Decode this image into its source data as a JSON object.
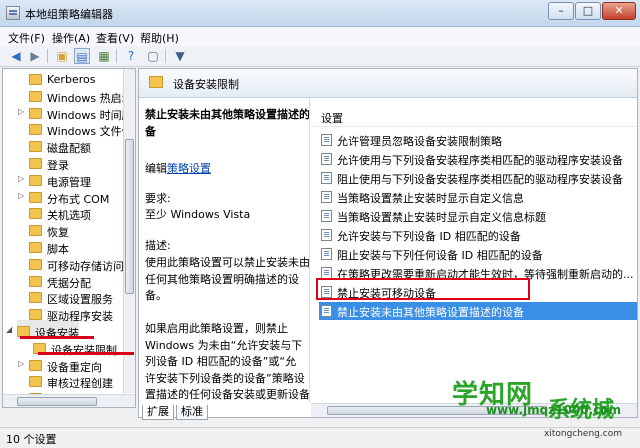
{
  "window": {
    "title": "本地组策略编辑器",
    "min": "–",
    "max": "□",
    "close": "✕"
  },
  "menu": [
    "文件(F)",
    "操作(A)",
    "查看(V)",
    "帮助(H)"
  ],
  "toolbar_icons": [
    "back-icon",
    "forward-icon",
    "up-folder-icon",
    "show-tree-icon",
    "export-icon",
    "help-icon",
    "properties-icon",
    "filter-icon"
  ],
  "tree": {
    "items": [
      {
        "label": "Kerberos",
        "expander": ""
      },
      {
        "label": "Windows 热启动",
        "expander": ""
      },
      {
        "label": "Windows 时间服务",
        "expander": "▷"
      },
      {
        "label": "Windows 文件保护",
        "expander": ""
      },
      {
        "label": "磁盘配额",
        "expander": ""
      },
      {
        "label": "登录",
        "expander": ""
      },
      {
        "label": "电源管理",
        "expander": "▷"
      },
      {
        "label": "分布式 COM",
        "expander": "▷"
      },
      {
        "label": "关机选项",
        "expander": ""
      },
      {
        "label": "恢复",
        "expander": ""
      },
      {
        "label": "脚本",
        "expander": ""
      },
      {
        "label": "可移动存储访问",
        "expander": ""
      },
      {
        "label": "凭据分配",
        "expander": ""
      },
      {
        "label": "区域设置服务",
        "expander": ""
      },
      {
        "label": "驱动程序安装",
        "expander": ""
      },
      {
        "label": "设备安装",
        "expander": "◢"
      },
      {
        "label": "设备安装限制",
        "expander": ""
      },
      {
        "label": "设备重定向",
        "expander": "▷"
      },
      {
        "label": "审核过程创建",
        "expander": ""
      },
      {
        "label": "受信任的平台模块",
        "expander": "▷"
      }
    ]
  },
  "right": {
    "header": "设备安装限制",
    "description": {
      "title_lines": [
        "禁止安装未由其他策略设置描述的设",
        "备"
      ],
      "edit_prefix": "编辑",
      "edit_link": "策略设置",
      "req_label": "要求:",
      "req_value": "至少 Windows Vista",
      "desc_label": "描述:",
      "desc_lines": [
        "使用此策略设置可以禁止安装未由",
        "任何其他策略设置明确描述的设",
        "备。",
        "",
        "如果启用此策略设置，则禁止",
        "Windows 为未由“允许安装与下",
        "列设备 ID 相匹配的设备”或“允",
        "许安装下列设备类的设备”策略设",
        "置描述的任何设备安装或更新设备",
        "驱动程序。"
      ]
    },
    "list_header": "设置",
    "settings": [
      "允许管理员忽略设备安装限制策略",
      "允许使用与下列设备安装程序类相匹配的驱动程序安装设备",
      "阻止使用与下列设备安装程序类相匹配的驱动程序安装设备",
      "当策略设置禁止安装时显示自定义信息",
      "当策略设置禁止安装时显示自定义信息标题",
      "允许安装与下列设备 ID 相匹配的设备",
      "阻止安装与下列任何设备 ID 相匹配的设备",
      "在策略更改需要重新启动才能生效时，等待强制重新启动的...",
      "禁止安装可移动设备",
      "禁止安装未由其他策略设置描述的设备"
    ],
    "selected_index": 9
  },
  "tabs": [
    "扩展",
    "标准"
  ],
  "status": "10 个设置",
  "watermark": {
    "line1": "学知网",
    "line2": "系统城",
    "line3": "www.jmqz1000.com",
    "line4": "xitongcheng.com"
  }
}
